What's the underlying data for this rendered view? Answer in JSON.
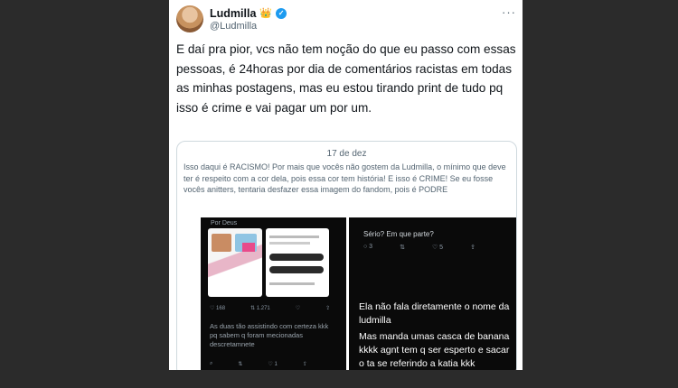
{
  "tweet": {
    "display_name": "Ludmilla",
    "crown_glyph": "👑",
    "verified_glyph": "✓",
    "handle": "@Ludmilla",
    "more_glyph": "···",
    "text": "E daí pra pior, vcs não tem noção do que eu passo com essas pessoas, é 24horas por dia de comentários racistas em todas as minhas postagens, mas eu estou tirando print de tudo pq isso é crime e vai pagar um por um."
  },
  "quote": {
    "date": "17 de dez",
    "text": "Isso daqui é RACISMO! Por mais que vocês não gostem da Ludmilla, o mínimo que deve ter é respeito com a cor dela, pois essa cor tem história! E isso é CRIME! Se eu fosse vocês anitters, tentaria desfazer essa imagem do fandom, pois é PODRE"
  },
  "screenshot_left": {
    "title": "Por Deus",
    "actions": [
      "♡ 168",
      "⇅ 1.271",
      "♡",
      "⇪"
    ],
    "caption": "As duas tão assistindo com certeza kkk pq sabem q foram mecionadas descretamnete",
    "actions_bottom": [
      "⌕",
      "⇅",
      "♡ 1",
      "⇪"
    ]
  },
  "screenshot_right": {
    "question": "Sério? Em que parte?",
    "actions": [
      "○ 3",
      "⇅",
      "♡ 5",
      "⇪"
    ],
    "line1": "Ela não fala diretamente o nome da",
    "line2": "ludmilla",
    "line3": "Mas manda umas casca de banana kkkk agnt tem q ser esperto e sacar o ta se referindo a katia kkk"
  },
  "colors": {
    "background": "#2b2b2b",
    "card": "#ffffff",
    "verified": "#1d9bf0",
    "text_primary": "#0f1419",
    "text_secondary": "#536471"
  }
}
